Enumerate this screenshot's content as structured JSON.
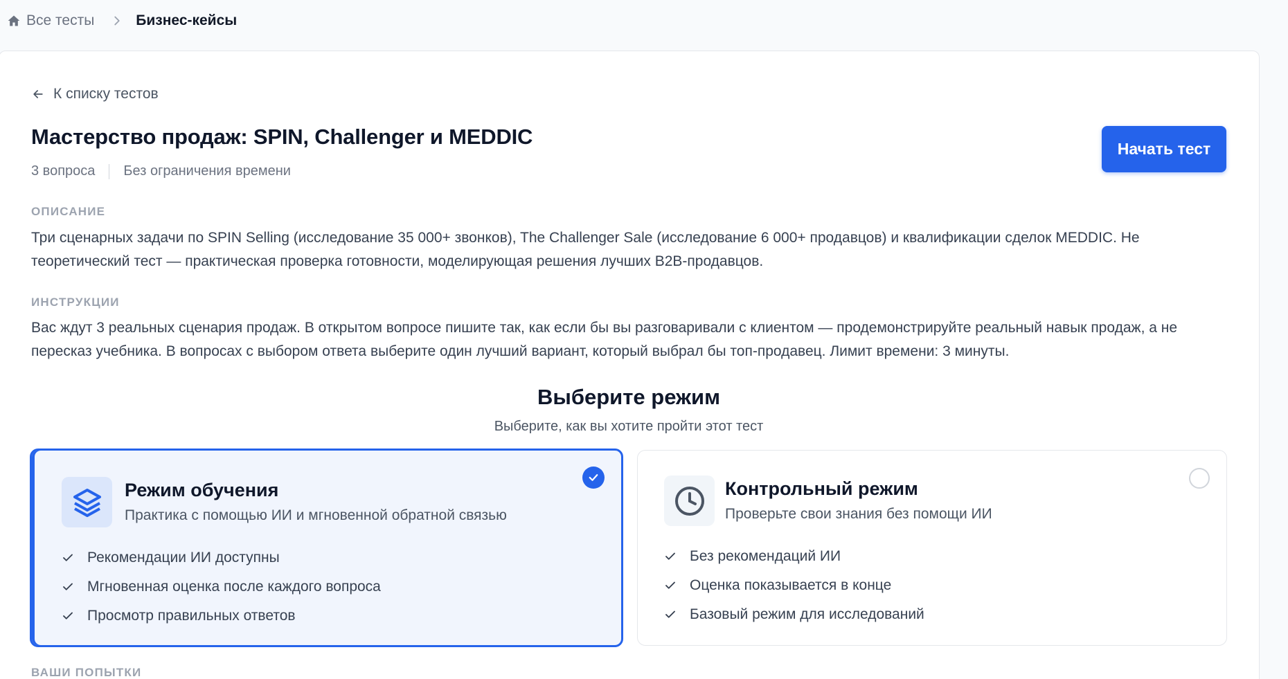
{
  "breadcrumb": {
    "home_label": "Все тесты",
    "current_label": "Бизнес-кейсы",
    "home_icon": "home-icon",
    "separator_icon": "chevron-right-icon"
  },
  "back_link": {
    "label": "К списку тестов",
    "icon": "arrow-left-icon"
  },
  "test": {
    "title": "Мастерство продаж: SPIN, Challenger и MEDDIC",
    "questions": "3 вопроса",
    "time_limit": "Без ограничения времени",
    "start_button": "Начать тест"
  },
  "description": {
    "label": "ОПИСАНИЕ",
    "text": "Три сценарных задачи по SPIN Selling (исследование 35 000+ звонков), The Challenger Sale (исследование 6 000+ продавцов) и квалификации сделок MEDDIC. Не теоретический тест — практическая проверка готовности, моделирующая решения лучших B2B-продавцов."
  },
  "instructions": {
    "label": "ИНСТРУКЦИИ",
    "text": "Вас ждут 3 реальных сценария продаж. В открытом вопросе пишите так, как если бы вы разговаривали с клиентом — продемонстрируйте реальный навык продаж, а не пересказ учебника. В вопросах с выбором ответа выберите один лучший вариант, который выбрал бы топ-продавец. Лимит времени: 3 минуты."
  },
  "mode_select": {
    "title": "Выберите режим",
    "subtitle": "Выберите, как вы хотите пройти этот тест",
    "modes": [
      {
        "name": "Режим обучения",
        "description": "Практика с помощью ИИ и мгновенной обратной связью",
        "icon": "layers-icon",
        "selected": true,
        "features": [
          "Рекомендации ИИ доступны",
          "Мгновенная оценка после каждого вопроса",
          "Просмотр правильных ответов"
        ]
      },
      {
        "name": "Контрольный режим",
        "description": "Проверьте свои знания без помощи ИИ",
        "icon": "clock-icon",
        "selected": false,
        "features": [
          "Без рекомендаций ИИ",
          "Оценка показывается в конце",
          "Базовый режим для исследований"
        ]
      }
    ]
  },
  "attempts": {
    "label": "ВАШИ ПОПЫТКИ"
  },
  "colors": {
    "accent": "#2563eb",
    "selected_card_bg": "#f1f5fd",
    "text_primary": "#0f172a",
    "text_muted": "#6b7280"
  }
}
